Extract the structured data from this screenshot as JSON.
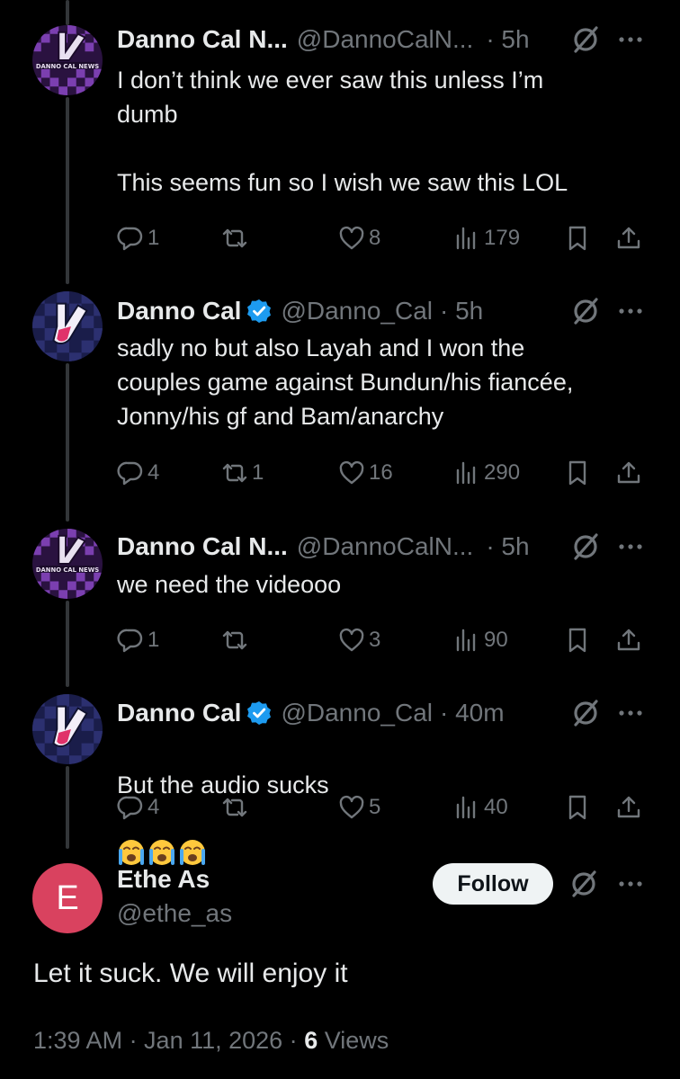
{
  "posts": [
    {
      "author": "Danno Cal N...",
      "handle": "@DannoCalN...",
      "time": "· 5h",
      "text": "I don’t think we ever saw this unless I’m\ndumb\n\nThis seems fun so I wish we saw this LOL",
      "replies": "1",
      "reposts": "",
      "likes": "8",
      "views": "179",
      "avatar_text": "DANNO CAL NEWS"
    },
    {
      "author": "Danno Cal",
      "handle": "@Danno_Cal",
      "time": "· 5h",
      "text": "sadly no but also Layah and I won the\ncouples game against Bundun/his fiancée,\nJonny/his gf and Bam/anarchy",
      "replies": "4",
      "reposts": "1",
      "likes": "16",
      "views": "290"
    },
    {
      "author": "Danno Cal N...",
      "handle": "@DannoCalN...",
      "time": "· 5h",
      "text": "we need the videooo",
      "replies": "1",
      "reposts": "",
      "likes": "3",
      "views": "90",
      "avatar_text": "DANNO CAL NEWS"
    },
    {
      "author": "Danno Cal",
      "handle": "@Danno_Cal",
      "time": "· 40m",
      "text": "But the audio sucks",
      "replies": "4",
      "reposts": "",
      "likes": "5",
      "views": "40"
    }
  ],
  "reply": {
    "avatar_letter": "E",
    "name": "Ethe As",
    "handle": "@ethe_as",
    "follow_label": "Follow",
    "text": "Let it suck. We will enjoy it",
    "timestamp": "1:39 AM · Jan 11, 2026 · ",
    "views_count": "6",
    "views_label": " Views"
  },
  "colors": {
    "background": "#000000",
    "text": "#e7e9ea",
    "muted": "#71767b",
    "verified": "#1d9bf0",
    "avatar_reply": "#d9425f"
  },
  "icons": [
    "reply-icon",
    "repost-icon",
    "like-icon",
    "views-icon",
    "bookmark-icon",
    "share-icon",
    "grok-icon",
    "more-icon",
    "verified-icon",
    "crying-emoji"
  ]
}
